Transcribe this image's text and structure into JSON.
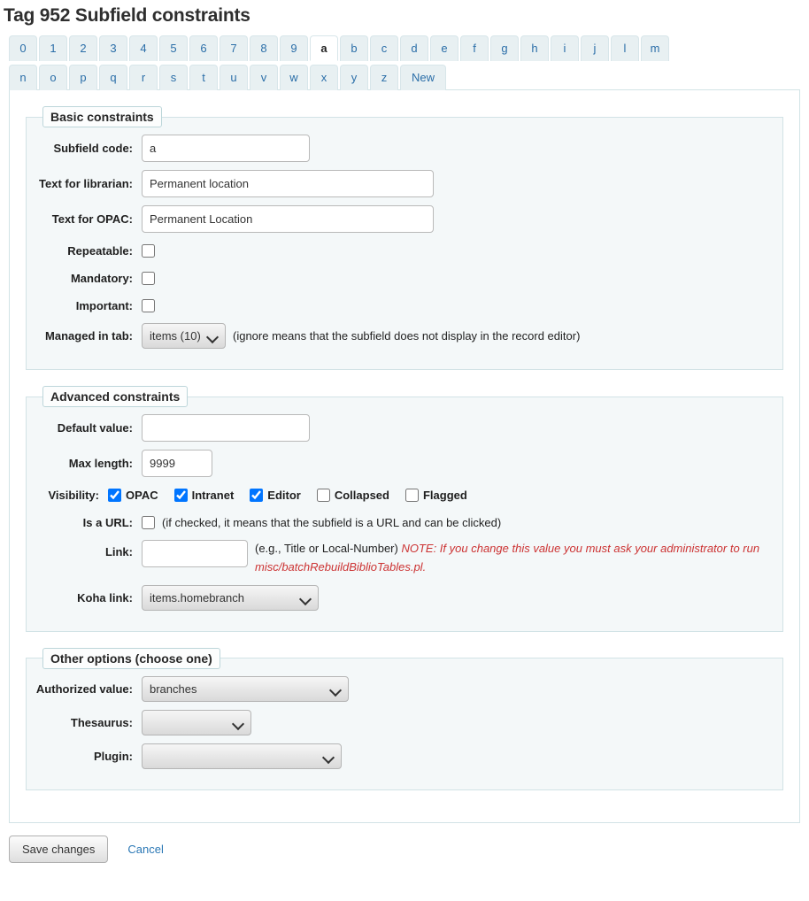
{
  "page": {
    "title": "Tag 952 Subfield constraints"
  },
  "tabs": {
    "active": "a",
    "row1": [
      {
        "label": "0"
      },
      {
        "label": "1"
      },
      {
        "label": "2"
      },
      {
        "label": "3"
      },
      {
        "label": "4"
      },
      {
        "label": "5"
      },
      {
        "label": "6"
      },
      {
        "label": "7"
      },
      {
        "label": "8"
      },
      {
        "label": "9"
      },
      {
        "label": "a"
      },
      {
        "label": "b"
      },
      {
        "label": "c"
      },
      {
        "label": "d"
      },
      {
        "label": "e"
      },
      {
        "label": "f"
      },
      {
        "label": "g"
      },
      {
        "label": "h"
      },
      {
        "label": "i"
      },
      {
        "label": "j"
      },
      {
        "label": "l"
      },
      {
        "label": "m"
      }
    ],
    "row2": [
      {
        "label": "n"
      },
      {
        "label": "o"
      },
      {
        "label": "p"
      },
      {
        "label": "q"
      },
      {
        "label": "r"
      },
      {
        "label": "s"
      },
      {
        "label": "t"
      },
      {
        "label": "u"
      },
      {
        "label": "v"
      },
      {
        "label": "w"
      },
      {
        "label": "x"
      },
      {
        "label": "y"
      },
      {
        "label": "z"
      },
      {
        "label": "New"
      }
    ]
  },
  "basic": {
    "legend": "Basic constraints",
    "subfield_code_label": "Subfield code:",
    "subfield_code_value": "a",
    "text_librarian_label": "Text for librarian:",
    "text_librarian_value": "Permanent location",
    "text_opac_label": "Text for OPAC:",
    "text_opac_value": "Permanent Location",
    "repeatable_label": "Repeatable:",
    "repeatable_checked": false,
    "mandatory_label": "Mandatory:",
    "mandatory_checked": false,
    "important_label": "Important:",
    "important_checked": false,
    "managed_tab_label": "Managed in tab:",
    "managed_tab_value": "items (10)",
    "managed_tab_hint": "(ignore means that the subfield does not display in the record editor)"
  },
  "advanced": {
    "legend": "Advanced constraints",
    "default_value_label": "Default value:",
    "default_value": "",
    "max_length_label": "Max length:",
    "max_length_value": "9999",
    "visibility_label": "Visibility:",
    "visibility": [
      {
        "label": "OPAC",
        "checked": true
      },
      {
        "label": "Intranet",
        "checked": true
      },
      {
        "label": "Editor",
        "checked": true
      },
      {
        "label": "Collapsed",
        "checked": false
      },
      {
        "label": "Flagged",
        "checked": false
      }
    ],
    "is_url_label": "Is a URL:",
    "is_url_checked": false,
    "is_url_hint": "(if checked, it means that the subfield is a URL and can be clicked)",
    "link_label": "Link:",
    "link_value": "",
    "link_hint": "(e.g., Title or Local-Number)",
    "link_note": "NOTE: If you change this value you must ask your administrator to run misc/batchRebuildBiblioTables.pl.",
    "koha_link_label": "Koha link:",
    "koha_link_value": "items.homebranch"
  },
  "other": {
    "legend": "Other options (choose one)",
    "authorized_value_label": "Authorized value:",
    "authorized_value": "branches",
    "thesaurus_label": "Thesaurus:",
    "thesaurus_value": "",
    "plugin_label": "Plugin:",
    "plugin_value": ""
  },
  "footer": {
    "save_label": "Save changes",
    "cancel_label": "Cancel"
  },
  "colors": {
    "accent": "#2b6ea8",
    "tab_bg": "#e8f0f2",
    "fieldset_bg": "#f4f8f9",
    "border": "#d2e3e6",
    "note_red": "#cc3333"
  }
}
